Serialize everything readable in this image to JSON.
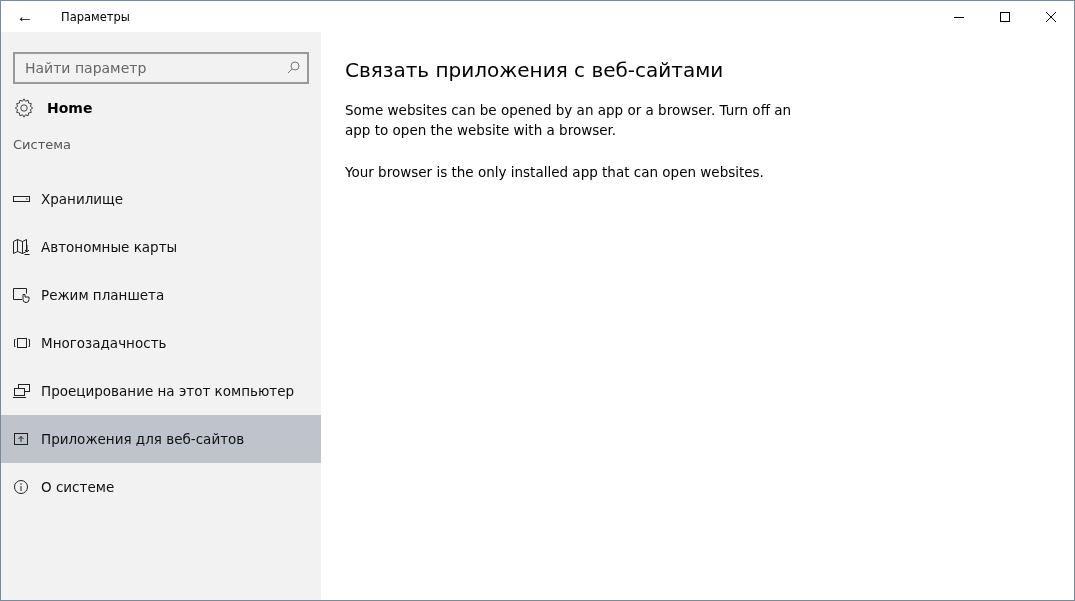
{
  "window": {
    "title": "Параметры",
    "back": "←"
  },
  "sidebar": {
    "search": {
      "placeholder": "Найти параметр"
    },
    "home": "Home",
    "section": "Система",
    "items": [
      {
        "kind": "storage",
        "label": "Хранилище",
        "selected": false
      },
      {
        "kind": "maps",
        "label": "Автономные карты",
        "selected": false
      },
      {
        "kind": "tablet",
        "label": "Режим планшета",
        "selected": false
      },
      {
        "kind": "multitask",
        "label": "Многозадачность",
        "selected": false
      },
      {
        "kind": "project",
        "label": "Проецирование на этот компьютер",
        "selected": false
      },
      {
        "kind": "apps",
        "label": "Приложения для веб-сайтов",
        "selected": true
      },
      {
        "kind": "info",
        "label": "О системе",
        "selected": false
      }
    ]
  },
  "content": {
    "title": "Связать приложения с веб-сайтами",
    "paragraphs": [
      "Some websites can be opened by an app or a browser.  Turn off an app to open the website with a browser.",
      "Your browser is the only installed app that can open websites."
    ]
  }
}
